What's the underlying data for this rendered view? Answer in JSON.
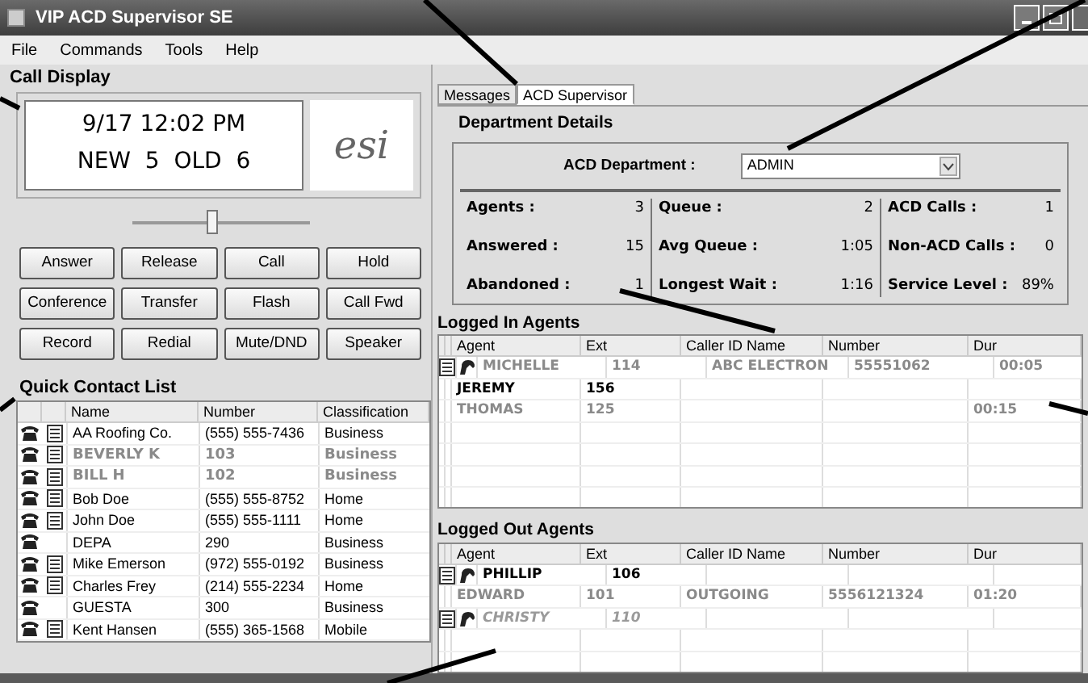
{
  "window": {
    "title": "VIP ACD Supervisor SE"
  },
  "menu": [
    "File",
    "Commands",
    "Tools",
    "Help"
  ],
  "call_display": {
    "title": "Call Display",
    "lines": [
      "9/17 12:02 PM",
      "NEW  5  OLD  6"
    ],
    "logo": "esi",
    "volume": {
      "level": 0.45
    }
  },
  "buttons": [
    "Answer",
    "Release",
    "Call",
    "Hold",
    "Conference",
    "Transfer",
    "Flash",
    "Call Fwd",
    "Record",
    "Redial",
    "Mute/DND",
    "Speaker"
  ],
  "quick_contacts": {
    "title": "Quick Contact List",
    "columns": [
      "Name",
      "Number",
      "Classification"
    ],
    "rows": [
      {
        "name": "AA Roofing Co.",
        "number": "(555) 555-7436",
        "classification": "Business",
        "kind": "normal",
        "note": true
      },
      {
        "name": "BEVERLY K",
        "number": "103",
        "classification": "Business",
        "kind": "dim-bold",
        "note": true
      },
      {
        "name": "BILL H",
        "number": "102",
        "classification": "Business",
        "kind": "dim-bold",
        "note": true
      },
      {
        "name": "Bob Doe",
        "number": "(555) 555-8752",
        "classification": "Home",
        "kind": "normal",
        "note": true
      },
      {
        "name": "John Doe",
        "number": "(555) 555-1111",
        "classification": "Home",
        "kind": "normal",
        "note": true
      },
      {
        "name": "DEPA",
        "number": "290",
        "classification": "Business",
        "kind": "normal",
        "note": false
      },
      {
        "name": "Mike Emerson",
        "number": "(972) 555-0192",
        "classification": "Business",
        "kind": "normal",
        "note": true
      },
      {
        "name": "Charles Frey",
        "number": "(214) 555-2234",
        "classification": "Home",
        "kind": "normal",
        "note": true
      },
      {
        "name": "GUESTA",
        "number": "300",
        "classification": "Business",
        "kind": "normal",
        "note": false
      },
      {
        "name": "Kent Hansen",
        "number": "(555) 365-1568",
        "classification": "Mobile",
        "kind": "normal",
        "note": true
      }
    ]
  },
  "tabs": [
    {
      "label": "Messages",
      "selected": false
    },
    {
      "label": "ACD Supervisor",
      "selected": true
    }
  ],
  "department": {
    "title": "Department Details",
    "label": "ACD Department :",
    "value": "ADMIN",
    "stats": [
      [
        {
          "label": "Agents :",
          "value": "3"
        },
        {
          "label": "Answered :",
          "value": "15"
        },
        {
          "label": "Abandoned :",
          "value": "1"
        }
      ],
      [
        {
          "label": "Queue :",
          "value": "2"
        },
        {
          "label": "Avg Queue :",
          "value": "1:05"
        },
        {
          "label": "Longest Wait :",
          "value": "1:16"
        }
      ],
      [
        {
          "label": "ACD Calls :",
          "value": "1"
        },
        {
          "label": "Non-ACD Calls :",
          "value": "0"
        },
        {
          "label": "Service  Level :",
          "value": "89%"
        }
      ]
    ]
  },
  "logged_in": {
    "title": "Logged In Agents",
    "columns": [
      "Agent",
      "Ext",
      "Caller ID Name",
      "Number",
      "Dur"
    ],
    "rows": [
      {
        "agent": "MICHELLE",
        "ext": "114",
        "caller_id_name": "ABC ELECTRON",
        "number": "55551062",
        "dur": "00:05",
        "kind": "dim-bold",
        "icons": true
      },
      {
        "agent": "JEREMY",
        "ext": "156",
        "kind": "bold",
        "icons": false
      },
      {
        "agent": "THOMAS",
        "ext": "125",
        "dur": "00:15",
        "kind": "dim-bold",
        "icons": false
      }
    ]
  },
  "logged_out": {
    "title": "Logged Out Agents",
    "columns": [
      "Agent",
      "Ext",
      "Caller ID Name",
      "Number",
      "Dur"
    ],
    "rows": [
      {
        "agent": "PHILLIP",
        "ext": "106",
        "kind": "bold",
        "icons": true
      },
      {
        "agent": "EDWARD",
        "ext": "101",
        "caller_id_name": "OUTGOING",
        "number": "5556121324",
        "dur": "01:20",
        "kind": "dim-bold",
        "icons": false
      },
      {
        "agent": "CHRISTY",
        "ext": "110",
        "kind": "dim-italic",
        "icons": true
      }
    ]
  }
}
